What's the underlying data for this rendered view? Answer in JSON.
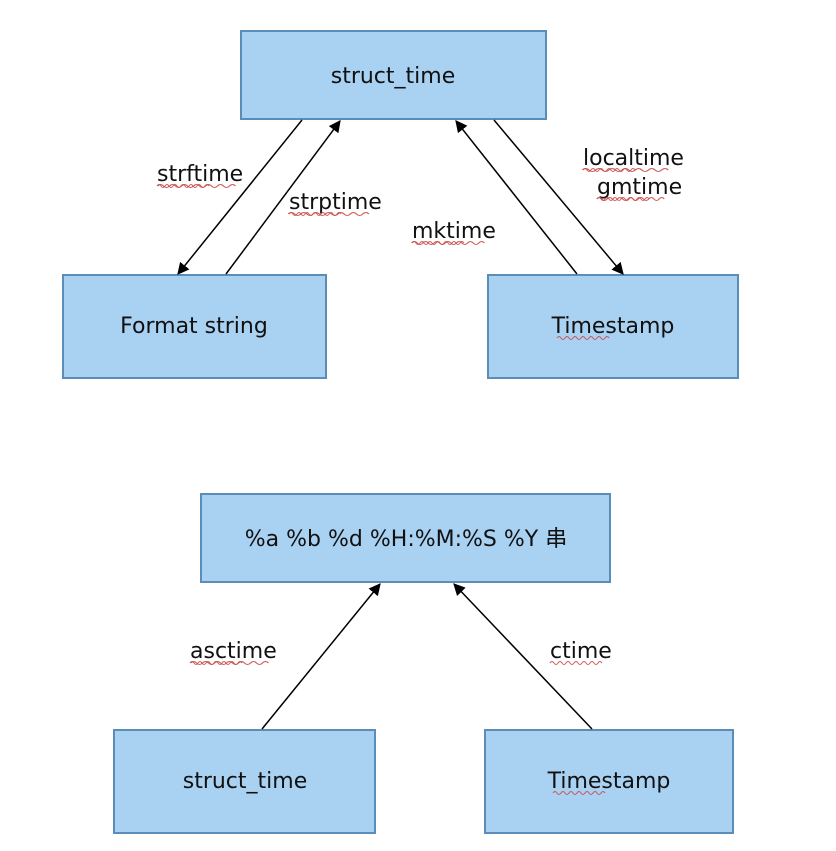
{
  "diagram1": {
    "top": "struct_time",
    "left": "Format string",
    "right": "Timestamp",
    "edges": {
      "top_to_left": "strftime",
      "left_to_top": "strptime",
      "right_to_top": "mktime",
      "top_to_right_1": "localtime",
      "top_to_right_2": "gmtime"
    }
  },
  "diagram2": {
    "top": "%a %b %d %H:%M:%S %Y 串",
    "left": "struct_time",
    "right": "Timestamp",
    "edges": {
      "left_to_top": "asctime",
      "right_to_top": "ctime"
    }
  }
}
